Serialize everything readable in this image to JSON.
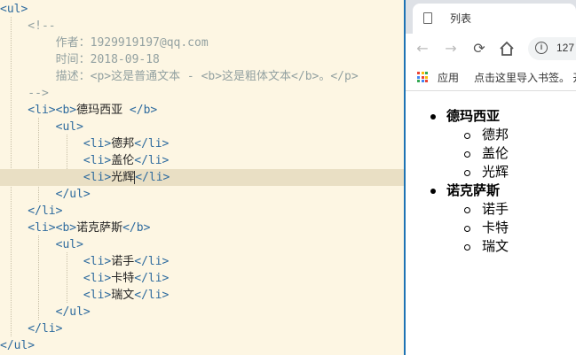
{
  "editor": {
    "lines": [
      {
        "parts": [
          {
            "k": "t",
            "v": "<ul>"
          }
        ]
      },
      {
        "parts": [
          {
            "k": "c",
            "v": "    <!--"
          }
        ]
      },
      {
        "parts": [
          {
            "k": "c",
            "v": "        作者：1929919197@qq.com"
          }
        ]
      },
      {
        "parts": [
          {
            "k": "c",
            "v": "        时间：2018-09-18"
          }
        ]
      },
      {
        "parts": [
          {
            "k": "c",
            "v": "        描述：<p>这是普通文本 - <b>这是粗体文本</b>。</p>"
          }
        ]
      },
      {
        "parts": [
          {
            "k": "c",
            "v": "    -->"
          }
        ]
      },
      {
        "parts": [
          {
            "k": "t",
            "v": "    <li><b>"
          },
          {
            "k": "x",
            "v": "德玛西亚 "
          },
          {
            "k": "t",
            "v": "</b>"
          }
        ]
      },
      {
        "parts": [
          {
            "k": "t",
            "v": "        <ul>"
          }
        ]
      },
      {
        "parts": [
          {
            "k": "t",
            "v": "            <li>"
          },
          {
            "k": "x",
            "v": "德邦"
          },
          {
            "k": "t",
            "v": "</li>"
          }
        ]
      },
      {
        "parts": [
          {
            "k": "t",
            "v": "            <li>"
          },
          {
            "k": "x",
            "v": "盖伦"
          },
          {
            "k": "t",
            "v": "</li>"
          }
        ]
      },
      {
        "parts": [
          {
            "k": "t",
            "v": "            <li>"
          },
          {
            "k": "x",
            "v": "光辉"
          },
          {
            "k": "caret",
            "v": ""
          },
          {
            "k": "t",
            "v": "</li>"
          }
        ],
        "highlight": true
      },
      {
        "parts": [
          {
            "k": "t",
            "v": "        </ul>"
          }
        ]
      },
      {
        "parts": [
          {
            "k": "t",
            "v": "    </li>"
          }
        ]
      },
      {
        "parts": [
          {
            "k": "t",
            "v": "    <li><b>"
          },
          {
            "k": "x",
            "v": "诺克萨斯"
          },
          {
            "k": "t",
            "v": "</b>"
          }
        ]
      },
      {
        "parts": [
          {
            "k": "t",
            "v": "        <ul>"
          }
        ]
      },
      {
        "parts": [
          {
            "k": "t",
            "v": "            <li>"
          },
          {
            "k": "x",
            "v": "诺手"
          },
          {
            "k": "t",
            "v": "</li>"
          }
        ]
      },
      {
        "parts": [
          {
            "k": "t",
            "v": "            <li>"
          },
          {
            "k": "x",
            "v": "卡特"
          },
          {
            "k": "t",
            "v": "</li>"
          }
        ]
      },
      {
        "parts": [
          {
            "k": "t",
            "v": "            <li>"
          },
          {
            "k": "x",
            "v": "瑞文"
          },
          {
            "k": "t",
            "v": "</li>"
          }
        ]
      },
      {
        "parts": [
          {
            "k": "t",
            "v": "        </ul>"
          }
        ]
      },
      {
        "parts": [
          {
            "k": "t",
            "v": "    </li>"
          }
        ]
      },
      {
        "parts": [
          {
            "k": "t",
            "v": "</ul>"
          }
        ]
      }
    ]
  },
  "browser": {
    "tab_title": "列表",
    "address_text": "127",
    "bookmarks": {
      "apps_label": "应用",
      "import_label": "点击这里导入书签。 开"
    },
    "list": [
      {
        "label": "德玛西亚",
        "children": [
          "德邦",
          "盖伦",
          "光辉"
        ]
      },
      {
        "label": "诺克萨斯",
        "children": [
          "诺手",
          "卡特",
          "瑞文"
        ]
      }
    ]
  },
  "colors": {
    "tag": "#2e6b9e",
    "comment": "#93a1a1",
    "editor_bg": "#fdf6e3",
    "highlight": "#e9dfc4",
    "divider": "#1e73b4"
  },
  "icons": [
    "document-icon",
    "back-arrow-icon",
    "forward-arrow-icon",
    "reload-icon",
    "home-icon",
    "info-icon",
    "apps-grid-icon"
  ]
}
